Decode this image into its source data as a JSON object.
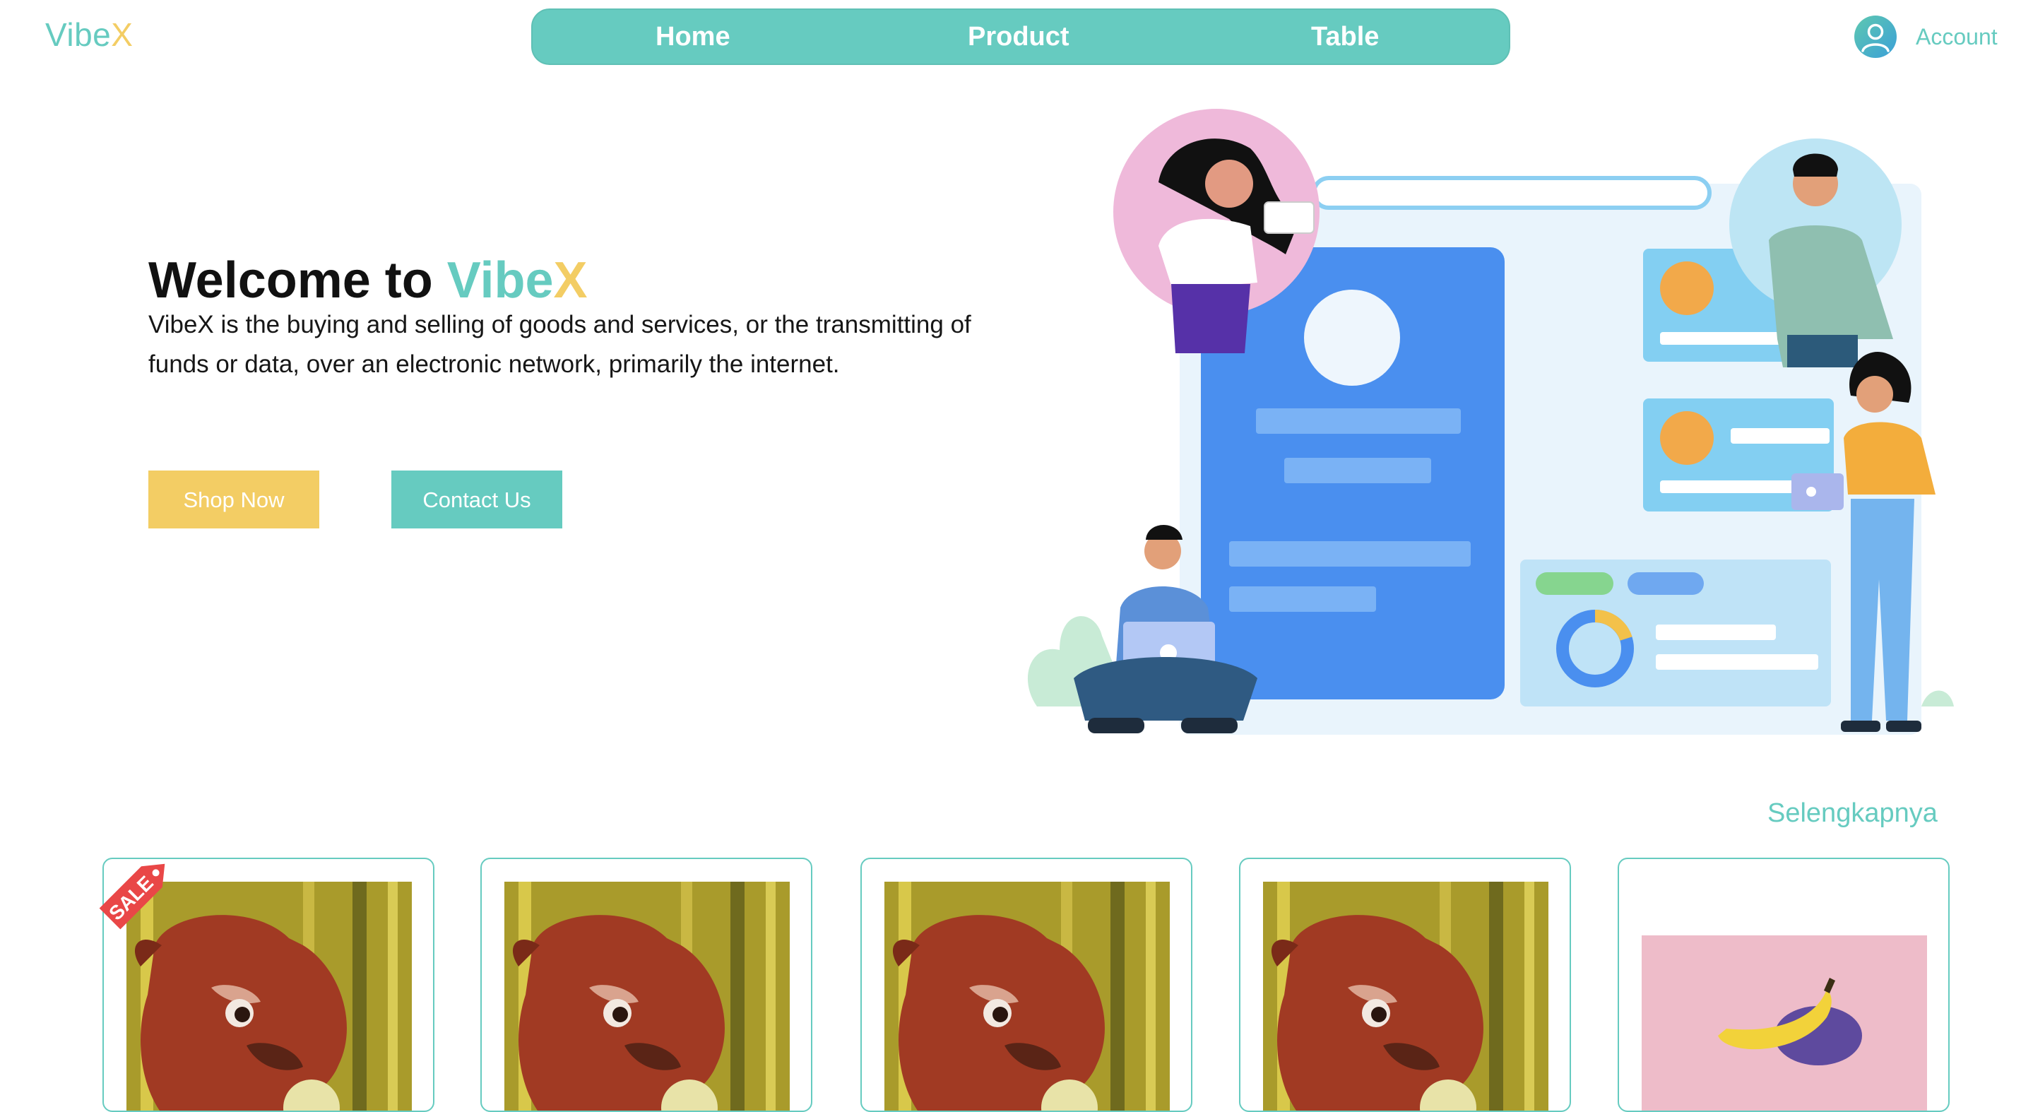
{
  "brand": {
    "part1": "Vibe",
    "part2": "X"
  },
  "nav": [
    {
      "label": "Home"
    },
    {
      "label": "Product"
    },
    {
      "label": "Table"
    }
  ],
  "account": {
    "label": "Account",
    "icon": "user-icon"
  },
  "hero": {
    "title_prefix": "Welcome to",
    "title_brand1": "Vibe",
    "title_brand2": "X",
    "description": "VibeX is the buying and selling of goods and services, or the transmitting of funds or data, over an electronic network, primarily the internet.",
    "shop_button": "Shop Now",
    "contact_button": "Contact Us"
  },
  "products_section": {
    "more_link": "Selengkapnya",
    "sale_badge": "SALE",
    "items": [
      {
        "image": "animal-image",
        "sale": true
      },
      {
        "image": "animal-image",
        "sale": false
      },
      {
        "image": "animal-image",
        "sale": false
      },
      {
        "image": "animal-image",
        "sale": false
      },
      {
        "image": "banana-image",
        "sale": false
      }
    ]
  },
  "colors": {
    "accent": "#66cbc0",
    "brand_yellow": "#f3cd64",
    "text": "#111111",
    "illustration_blue": "#4a8fef"
  }
}
